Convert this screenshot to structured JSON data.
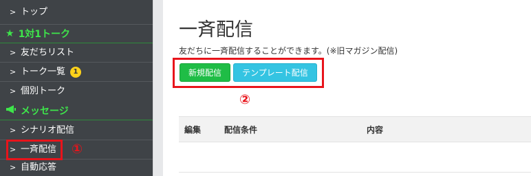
{
  "sidebar": {
    "top_item": "トップ",
    "section_one_to_one": "1対1トーク",
    "friends_list": "友だちリスト",
    "talk_list": "トーク一覧",
    "talk_list_badge": "1",
    "individual_talk": "個別トーク",
    "section_message": "メッセージ",
    "scenario": "シナリオ配信",
    "broadcast": "一斉配信",
    "auto_reply": "自動応答"
  },
  "icons": {
    "chevron": "chevron-right-icon",
    "star": "star-icon",
    "megaphone": "megaphone-icon"
  },
  "annotations": {
    "marker_1": "①",
    "marker_2": "②"
  },
  "main": {
    "title": "一斉配信",
    "description": "友だちに一斉配信することができます。(※旧マガジン配信)",
    "new_button": "新規配信",
    "template_button": "テンプレート配信",
    "table_headers": [
      "編集",
      "配信条件",
      "内容"
    ]
  },
  "colors": {
    "sidebar_bg": "#3f4347",
    "section_green": "#3ee64b",
    "annotation_red": "#e8141b",
    "button_green": "#1fbd46",
    "button_cyan": "#34c4e2",
    "badge_yellow": "#ffd21a"
  }
}
